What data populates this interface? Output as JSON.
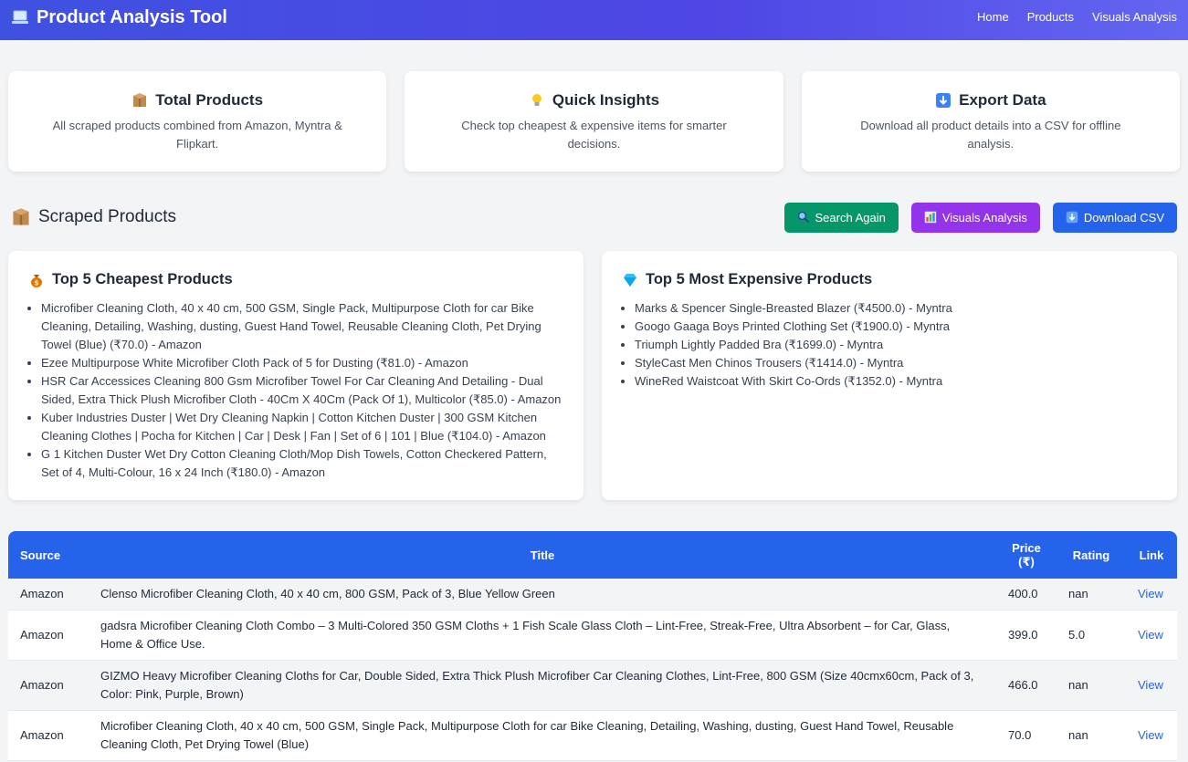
{
  "header": {
    "title": "Product Analysis Tool",
    "nav": [
      "Home",
      "Products",
      "Visuals Analysis"
    ]
  },
  "features": [
    {
      "icon": "package-icon",
      "title": "Total Products",
      "desc": "All scraped products combined from Amazon, Myntra & Flipkart."
    },
    {
      "icon": "lightbulb-icon",
      "title": "Quick Insights",
      "desc": "Check top cheapest & expensive items for smarter decisions."
    },
    {
      "icon": "download-icon",
      "title": "Export Data",
      "desc": "Download all product details into a CSV for offline analysis."
    }
  ],
  "section": {
    "title": "Scraped Products",
    "buttons": {
      "search_again": "Search Again",
      "visuals": "Visuals Analysis",
      "download": "Download CSV"
    }
  },
  "cheapest": {
    "title": "Top 5 Cheapest Products",
    "items": [
      "Microfiber Cleaning Cloth, 40 x 40 cm, 500 GSM, Single Pack, Multipurpose Cloth for car Bike Cleaning, Detailing, Washing, dusting, Guest Hand Towel, Reusable Cleaning Cloth, Pet Drying Towel (Blue) (₹70.0) - Amazon",
      "Ezee Multipurpose White Microfiber Cloth Pack of 5 for Dusting (₹81.0) - Amazon",
      "HSR Car Accessices Cleaning 800 Gsm Microfiber Towel For Car Cleaning And Detailing - Dual Sided, Extra Thick Plush Microfiber Cloth - 40Cm X 40Cm (Pack Of 1), Multicolor (₹85.0) - Amazon",
      "Kuber Industries Duster | Wet Dry Cleaning Napkin | Cotton Kitchen Duster | 300 GSM Kitchen Cleaning Clothes | Pocha for Kitchen | Car | Desk | Fan | Set of 6 | 101 | Blue (₹104.0) - Amazon",
      "G 1 Kitchen Duster Wet Dry Cotton Cleaning Cloth/Mop Dish Towels, Cotton Checkered Pattern, Set of 4, Multi-Colour, 16 x 24 Inch (₹180.0) - Amazon"
    ]
  },
  "expensive": {
    "title": "Top 5 Most Expensive Products",
    "items": [
      "Marks & Spencer Single-Breasted Blazer (₹4500.0) - Myntra",
      "Googo Gaaga Boys Printed Clothing Set (₹1900.0) - Myntra",
      "Triumph Lightly Padded Bra (₹1699.0) - Myntra",
      "StyleCast Men Chinos Trousers (₹1414.0) - Myntra",
      "WineRed Waistcoat With Skirt Co-Ords (₹1352.0) - Myntra"
    ]
  },
  "table": {
    "headers": {
      "source": "Source",
      "title": "Title",
      "price": "Price (₹)",
      "rating": "Rating",
      "link": "Link"
    },
    "rows": [
      {
        "source": "Amazon",
        "title": "Clenso Microfiber Cleaning Cloth, 40 x 40 cm, 800 GSM, Pack of 3, Blue Yellow Green",
        "price": "400.0",
        "rating": "nan",
        "link": "View"
      },
      {
        "source": "Amazon",
        "title": "gadsra Microfiber Cleaning Cloth Combo – 3 Multi-Colored 350 GSM Cloths + 1 Fish Scale Glass Cloth – Lint-Free, Streak-Free, Ultra Absorbent – for Car, Glass, Home & Office Use.",
        "price": "399.0",
        "rating": "5.0",
        "link": "View"
      },
      {
        "source": "Amazon",
        "title": "GIZMO Heavy Microfiber Cleaning Cloths for Car, Double Sided, Extra Thick Plush Microfiber Car Cleaning Clothes, Lint-Free, 800 GSM (Size 40cmx60cm, Pack of 3, Color: Pink, Purple, Brown)",
        "price": "466.0",
        "rating": "nan",
        "link": "View"
      },
      {
        "source": "Amazon",
        "title": "Microfiber Cleaning Cloth, 40 x 40 cm, 500 GSM, Single Pack, Multipurpose Cloth for car Bike Cleaning, Detailing, Washing, dusting, Guest Hand Towel, Reusable Cleaning Cloth, Pet Drying Towel (Blue)",
        "price": "70.0",
        "rating": "nan",
        "link": "View"
      }
    ]
  },
  "colors": {
    "primary": "#2563eb",
    "green": "#059669",
    "purple": "#9333ea",
    "header_gradient": "#4f46e5"
  }
}
